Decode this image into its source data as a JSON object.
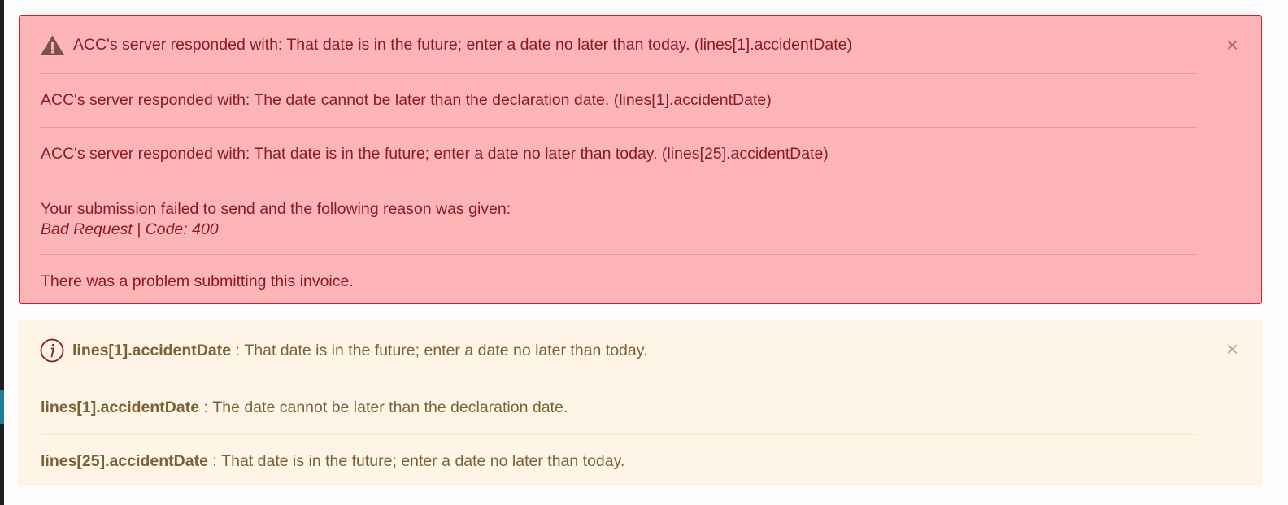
{
  "error_alert": {
    "icon": "warning-triangle-icon",
    "close_label": "×",
    "messages": [
      "ACC's server responded with: That date is in the future; enter a date no later than today. (lines[1].accidentDate)",
      "ACC's server responded with: The date cannot be later than the declaration date. (lines[1].accidentDate)",
      "ACC's server responded with: That date is in the future; enter a date no later than today. (lines[25].accidentDate)"
    ],
    "failure": {
      "text": "Your submission failed to send and the following reason was given:",
      "reason": "Bad Request | Code: 400"
    },
    "summary": "There was a problem submitting this invoice."
  },
  "warning_alert": {
    "icon": "info-circle-icon",
    "close_label": "×",
    "items": [
      {
        "field": "lines[1].accidentDate",
        "separator": " : ",
        "text": "That date is in the future; enter a date no later than today."
      },
      {
        "field": "lines[1].accidentDate",
        "separator": " : ",
        "text": "The date cannot be later than the declaration date."
      },
      {
        "field": "lines[25].accidentDate",
        "separator": " : ",
        "text": "That date is in the future; enter a date no later than today."
      }
    ]
  },
  "colors": {
    "error_bg": "#fdb5b8",
    "error_border": "#c9202b",
    "error_text": "#8a1a1f",
    "warning_bg": "#fef5e6",
    "warning_text": "#7a6236"
  }
}
